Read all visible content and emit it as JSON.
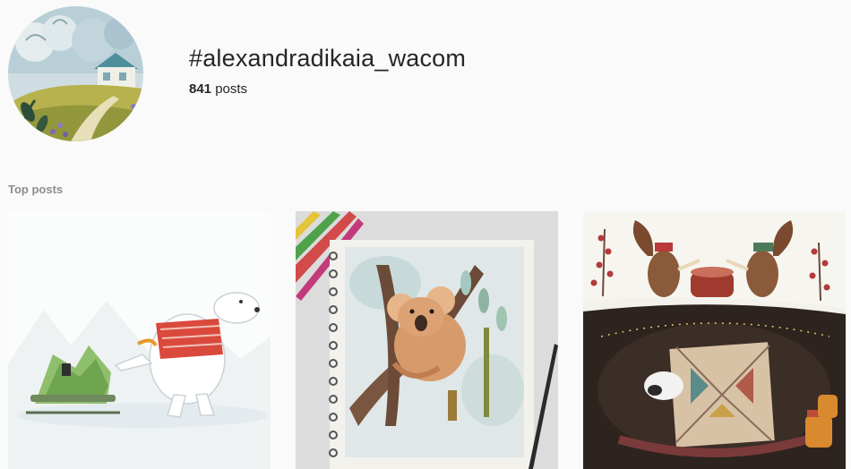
{
  "header": {
    "hashtag": "#alexandradikaia_wacom",
    "post_count": "841",
    "post_count_label": "posts"
  },
  "top_posts": {
    "title": "Top posts",
    "posts": [
      {
        "illustration": "polar-bear-pulling-sled-with-christmas-tree"
      },
      {
        "illustration": "koala-on-tree-watercolor-sketchbook-with-colored-pencils"
      },
      {
        "illustration": "squirrels-dancing-with-drum-above-sleeping-bear-burrow"
      }
    ]
  },
  "colors": {
    "background": "#fafafa",
    "text": "#262626",
    "muted": "#8e8e8e"
  }
}
